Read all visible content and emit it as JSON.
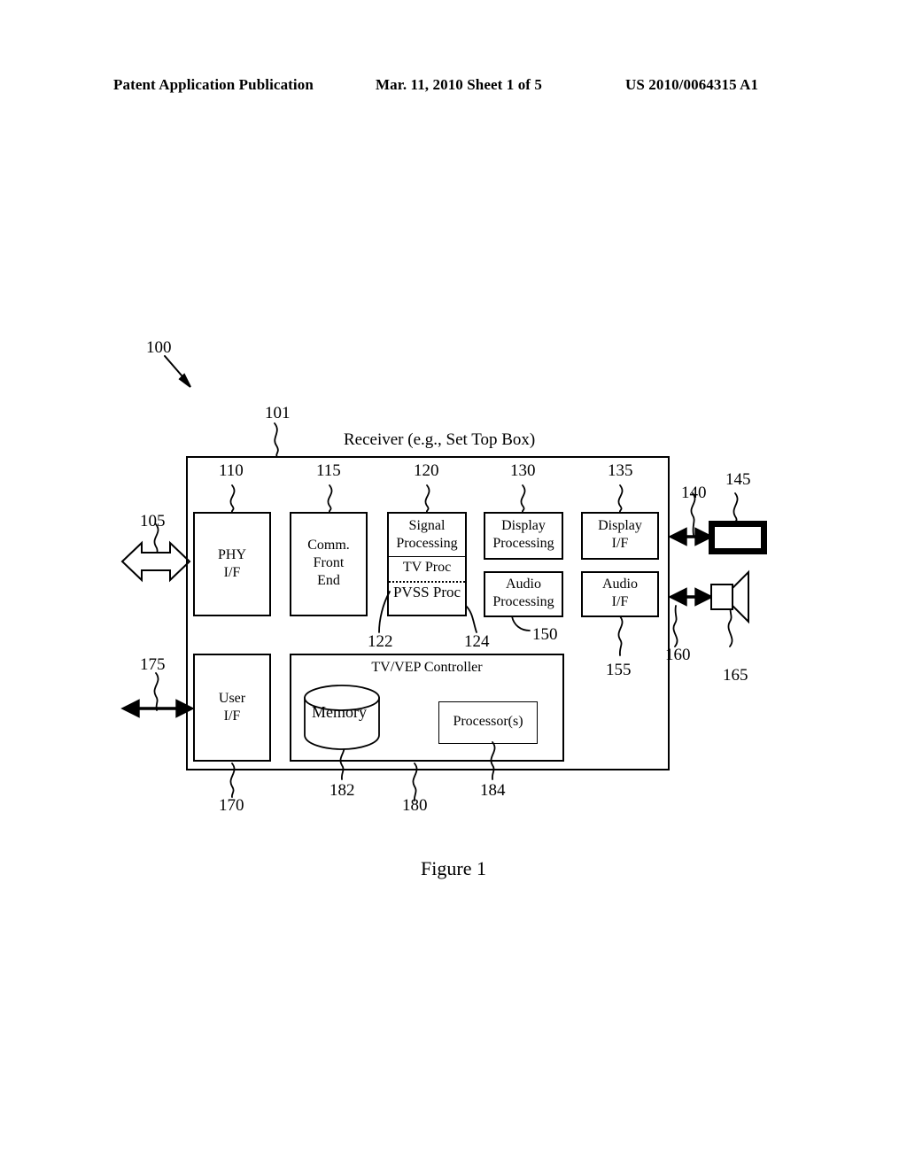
{
  "header": {
    "left": "Patent Application Publication",
    "middle": "Mar. 11, 2010  Sheet 1 of 5",
    "right": "US 2010/0064315 A1"
  },
  "figure": {
    "caption": "Figure 1",
    "system_label": "100",
    "outer_box_label": "101",
    "outer_box_title": "Receiver (e.g., Set Top Box)",
    "blocks": {
      "phy_if": {
        "line1": "PHY",
        "line2": "I/F",
        "ref": "110"
      },
      "comm_front_end": {
        "line1": "Comm.",
        "line2": "Front",
        "line3": "End",
        "ref": "115"
      },
      "signal_processing": {
        "title_line1": "Signal",
        "title_line2": "Processing",
        "sub1": "TV Proc",
        "sub2": "PVSS Proc",
        "ref": "120",
        "sub1_ref": "122",
        "sub2_ref": "124"
      },
      "display_processing": {
        "line1": "Display",
        "line2": "Processing",
        "ref": "130"
      },
      "audio_processing": {
        "line1": "Audio",
        "line2": "Processing",
        "ref": "150"
      },
      "display_if": {
        "line1": "Display",
        "line2": "I/F",
        "ref": "135"
      },
      "audio_if": {
        "line1": "Audio",
        "line2": "I/F",
        "ref": "155"
      },
      "user_if": {
        "line1": "User",
        "line2": "I/F",
        "ref": "170"
      },
      "controller": {
        "title": "TV/VEP Controller",
        "ref": "180"
      },
      "memory": {
        "label": "Memory",
        "ref": "182"
      },
      "processors": {
        "label": "Processor(s)",
        "ref": "184"
      }
    },
    "external": {
      "network_arrow_ref": "105",
      "user_arrow_ref": "175",
      "display_link_ref": "140",
      "display_device_ref": "145",
      "audio_link_ref": "160",
      "speaker_device_ref": "165"
    }
  }
}
